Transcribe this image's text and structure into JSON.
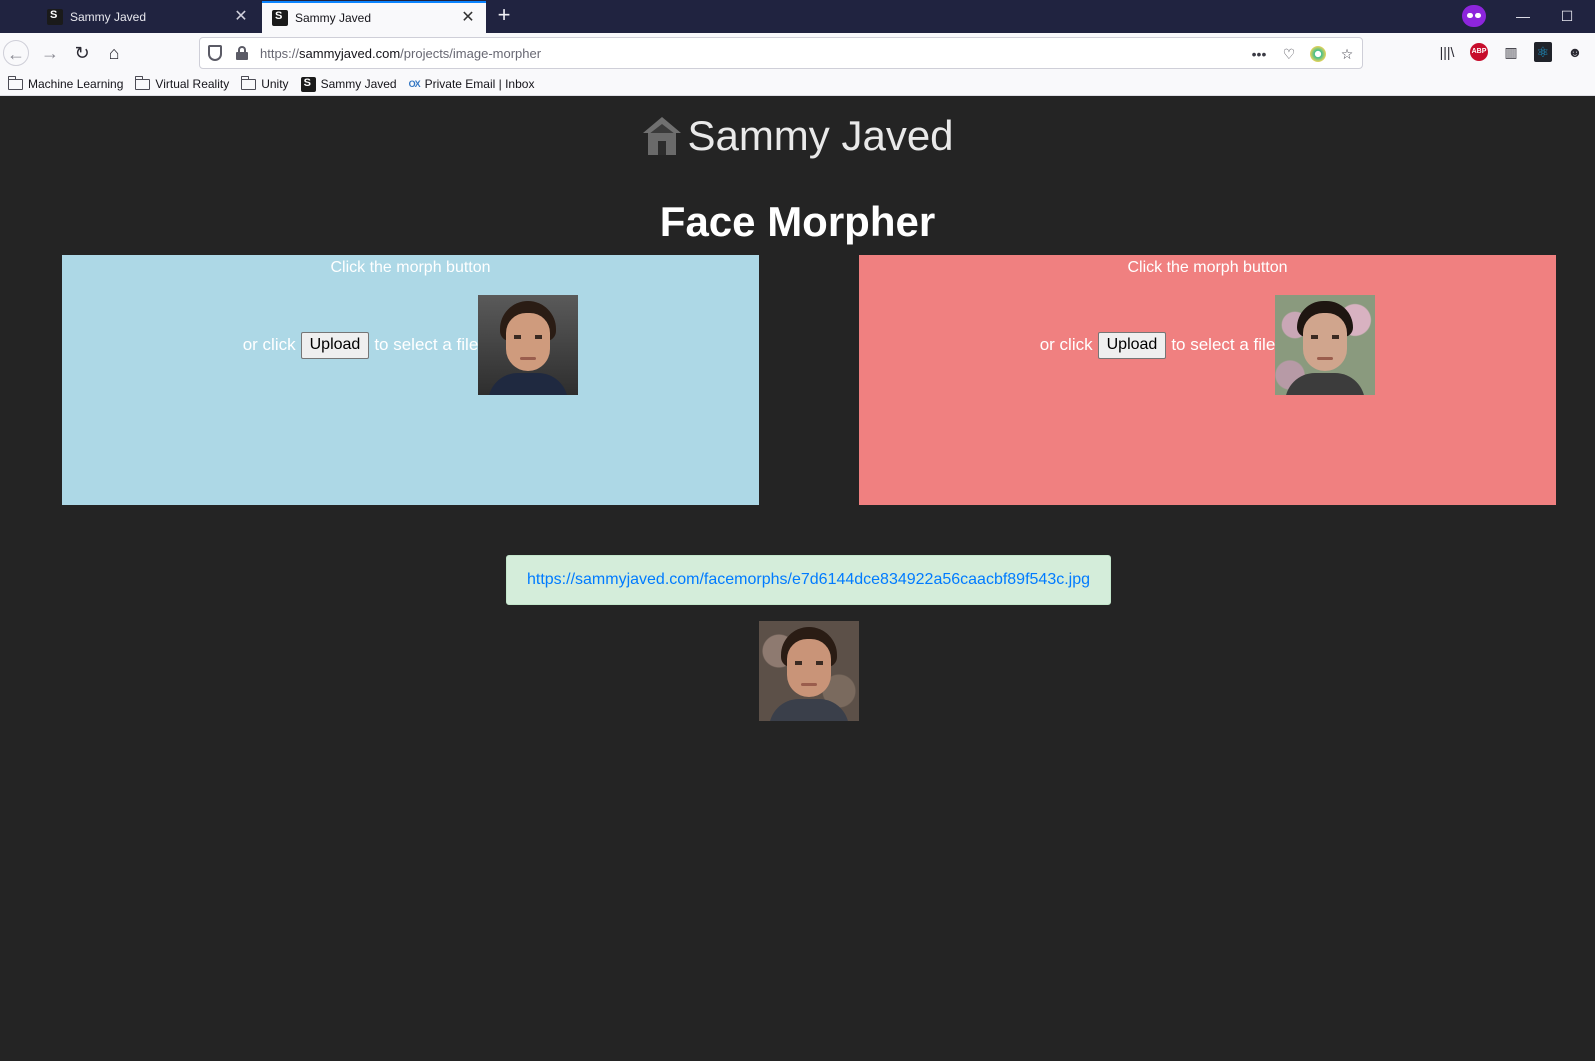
{
  "browser": {
    "tabs": [
      {
        "title": "Sammy Javed",
        "active": false
      },
      {
        "title": "Sammy Javed",
        "active": true
      }
    ],
    "url": {
      "scheme": "https://",
      "host": "sammyjaved.com",
      "path": "/projects/image-morpher"
    },
    "bookmarks": [
      {
        "label": "Machine Learning",
        "icon": "folder-icon"
      },
      {
        "label": "Virtual Reality",
        "icon": "folder-icon"
      },
      {
        "label": "Unity",
        "icon": "folder-icon"
      },
      {
        "label": "Sammy Javed",
        "icon": "site-favicon"
      },
      {
        "label": "Private Email | Inbox",
        "icon": "ox-favicon"
      }
    ],
    "accent_color": "#0a84ff",
    "tabstrip_color": "#202340"
  },
  "site": {
    "title": "Sammy Javed"
  },
  "page": {
    "title": "Face Morpher",
    "panels": [
      {
        "hint": "Click the morph button",
        "prefix": "or click",
        "button": "Upload",
        "suffix": "to select a file",
        "color": "#add8e6"
      },
      {
        "hint": "Click the morph button",
        "prefix": "or click",
        "button": "Upload",
        "suffix": "to select a file",
        "color": "#f08080"
      }
    ],
    "result_url": "https://sammyjaved.com/facemorphs/e7d6144dce834922a56caacbf89f543c.jpg"
  }
}
